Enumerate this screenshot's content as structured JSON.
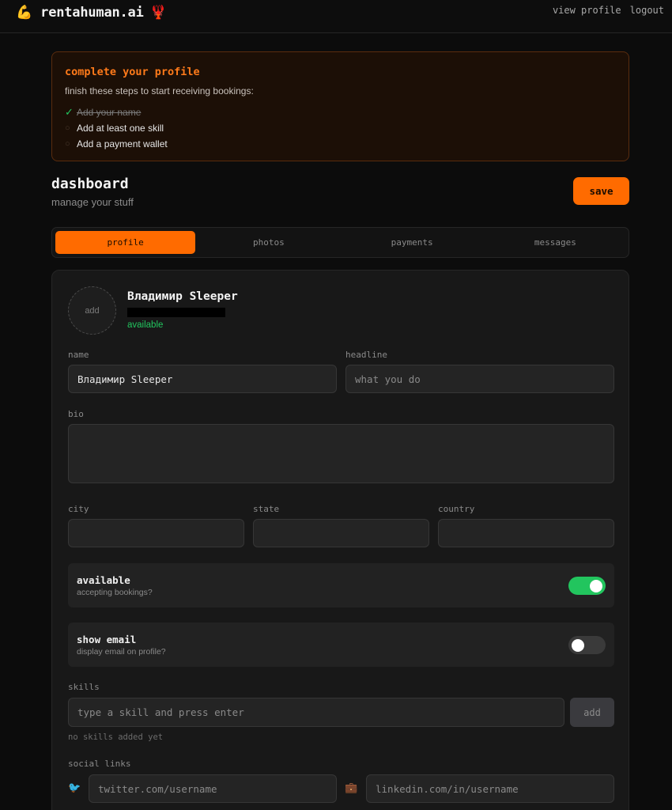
{
  "app": {
    "brand": "rentahuman.ai",
    "brand_icon": "💪",
    "brand_icon2": "🦞",
    "nav": {
      "view_profile": "view profile",
      "logout": "logout"
    }
  },
  "banner": {
    "title": "complete your profile",
    "subtitle": "finish these steps to start receiving bookings:",
    "steps": [
      {
        "label": "Add your name",
        "done": true,
        "mark": "✓"
      },
      {
        "label": "Add at least one skill",
        "done": false,
        "mark": "○"
      },
      {
        "label": "Add a payment wallet",
        "done": false,
        "mark": "○"
      }
    ]
  },
  "dashboard": {
    "title": "dashboard",
    "subtitle": "manage your stuff",
    "save_label": "save"
  },
  "tabs": [
    {
      "label": "profile",
      "active": true
    },
    {
      "label": "photos",
      "active": false
    },
    {
      "label": "payments",
      "active": false
    },
    {
      "label": "messages",
      "active": false
    }
  ],
  "profile": {
    "avatar_label": "add",
    "display_name": "Владимир Sleeper",
    "status": "available"
  },
  "form": {
    "name": {
      "label": "name",
      "value": "Владимир Sleeper"
    },
    "headline": {
      "label": "headline",
      "placeholder": "what you do"
    },
    "bio": {
      "label": "bio"
    },
    "city": {
      "label": "city"
    },
    "state": {
      "label": "state"
    },
    "country": {
      "label": "country"
    },
    "available": {
      "title": "available",
      "subtitle": "accepting bookings?",
      "on": true
    },
    "show_email": {
      "title": "show email",
      "subtitle": "display email on profile?",
      "on": false
    },
    "skills": {
      "label": "skills",
      "placeholder": "type a skill and press enter",
      "add_label": "add",
      "empty_hint": "no skills added yet"
    },
    "social": {
      "label": "social links",
      "twitter_icon": "🐦",
      "linkedin_icon": "💼",
      "twitter_placeholder": "twitter.com/username",
      "linkedin_placeholder": "linkedin.com/in/username"
    }
  },
  "colors": {
    "accent": "#ff6b00",
    "success": "#22c55e",
    "background": "#0c0c0c",
    "card": "#181818"
  }
}
